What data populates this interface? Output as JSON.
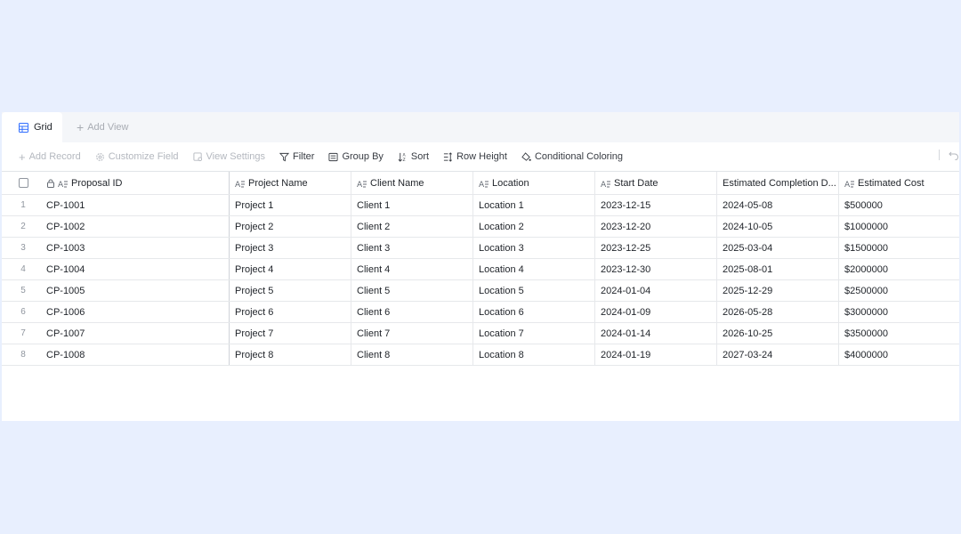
{
  "tabs": {
    "active_label": "Grid",
    "add_view_label": "Add View"
  },
  "toolbar": {
    "add_record": "Add Record",
    "customize_field": "Customize Field",
    "view_settings": "View Settings",
    "filter": "Filter",
    "group_by": "Group By",
    "sort": "Sort",
    "row_height": "Row Height",
    "conditional_coloring": "Conditional Coloring"
  },
  "columns": [
    "Proposal ID",
    "Project Name",
    "Client Name",
    "Location",
    "Start Date",
    "Estimated Completion D...",
    "Estimated Cost"
  ],
  "rows": [
    {
      "num": "1",
      "cells": [
        "CP-1001",
        "Project 1",
        "Client 1",
        "Location 1",
        "2023-12-15",
        "2024-05-08",
        "$500000"
      ]
    },
    {
      "num": "2",
      "cells": [
        "CP-1002",
        "Project 2",
        "Client 2",
        "Location 2",
        "2023-12-20",
        "2024-10-05",
        "$1000000"
      ]
    },
    {
      "num": "3",
      "cells": [
        "CP-1003",
        "Project 3",
        "Client 3",
        "Location 3",
        "2023-12-25",
        "2025-03-04",
        "$1500000"
      ]
    },
    {
      "num": "4",
      "cells": [
        "CP-1004",
        "Project 4",
        "Client 4",
        "Location 4",
        "2023-12-30",
        "2025-08-01",
        "$2000000"
      ]
    },
    {
      "num": "5",
      "cells": [
        "CP-1005",
        "Project 5",
        "Client 5",
        "Location 5",
        "2024-01-04",
        "2025-12-29",
        "$2500000"
      ]
    },
    {
      "num": "6",
      "cells": [
        "CP-1006",
        "Project 6",
        "Client 6",
        "Location 6",
        "2024-01-09",
        "2026-05-28",
        "$3000000"
      ]
    },
    {
      "num": "7",
      "cells": [
        "CP-1007",
        "Project 7",
        "Client 7",
        "Location 7",
        "2024-01-14",
        "2026-10-25",
        "$3500000"
      ]
    },
    {
      "num": "8",
      "cells": [
        "CP-1008",
        "Project 8",
        "Client 8",
        "Location 8",
        "2024-01-19",
        "2027-03-24",
        "$4000000"
      ]
    }
  ]
}
